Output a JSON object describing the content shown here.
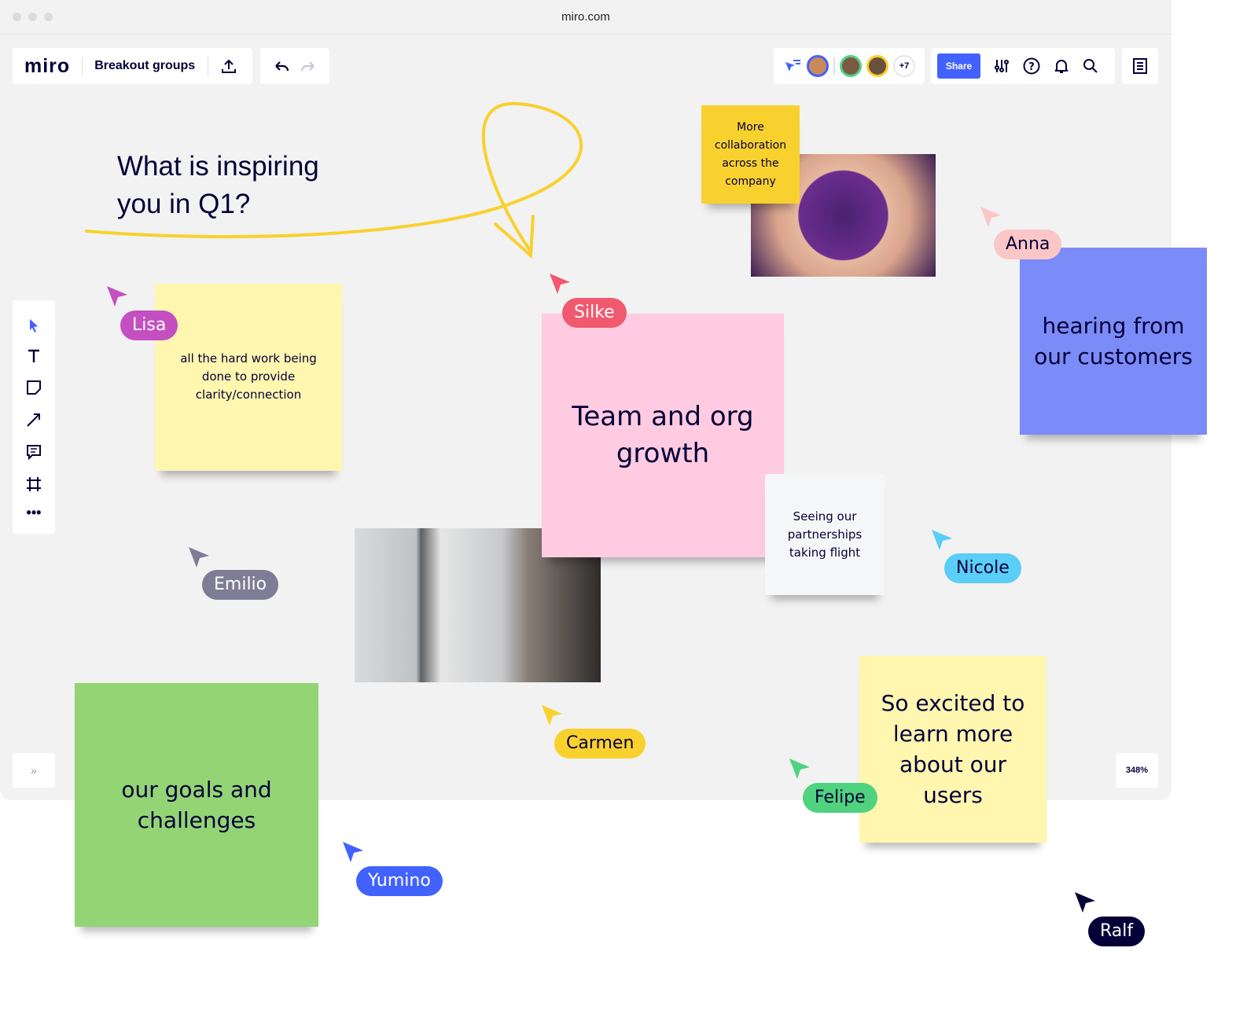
{
  "browser": {
    "url": "miro.com"
  },
  "toolbar": {
    "logo": "miro",
    "board_name": "Breakout groups",
    "share_label": "Share",
    "more_collaborators": "+7",
    "zoom_level": "348%"
  },
  "icons": [
    "upload-icon",
    "undo-icon",
    "redo-icon",
    "cursor-follow-icon",
    "settings-sliders-icon",
    "help-icon",
    "bell-icon",
    "search-icon",
    "notes-icon",
    "select-icon",
    "text-icon",
    "sticky-note-icon",
    "arrow-icon",
    "comment-icon",
    "frame-icon",
    "more-icon",
    "expand-icon"
  ],
  "board": {
    "heading": "What is inspiring you in Q1?",
    "stickies": [
      {
        "text": "More collaboration across the company",
        "color": "#f8d12f"
      },
      {
        "text": "all the hard work being done to provide clarity/connection",
        "color": "#fff6b0"
      },
      {
        "text": "Team and org growth",
        "color": "#ffcbe0"
      },
      {
        "text": "hearing from our customers",
        "color": "#7b8cf8"
      },
      {
        "text": "Seeing our partnerships taking flight",
        "color": "#f5f6f8"
      },
      {
        "text": "our goals and challenges",
        "color": "#93d475"
      },
      {
        "text": "So excited to learn more about our users",
        "color": "#fff6b0"
      }
    ],
    "cursors": [
      {
        "name": "Lisa",
        "color": "#c44fc0"
      },
      {
        "name": "Silke",
        "color": "#f0596e"
      },
      {
        "name": "Anna",
        "color": "#fbc6c6"
      },
      {
        "name": "Emilio",
        "color": "#7f7c95"
      },
      {
        "name": "Nicole",
        "color": "#5acdf8"
      },
      {
        "name": "Carmen",
        "color": "#f9d12e"
      },
      {
        "name": "Felipe",
        "color": "#50d27e"
      },
      {
        "name": "Yumino",
        "color": "#4262ff"
      },
      {
        "name": "Ralf",
        "color": "#050038"
      }
    ]
  },
  "colors": {
    "accent": "#4262ff",
    "ink": "#050038",
    "canvas": "#f2f2f2"
  }
}
